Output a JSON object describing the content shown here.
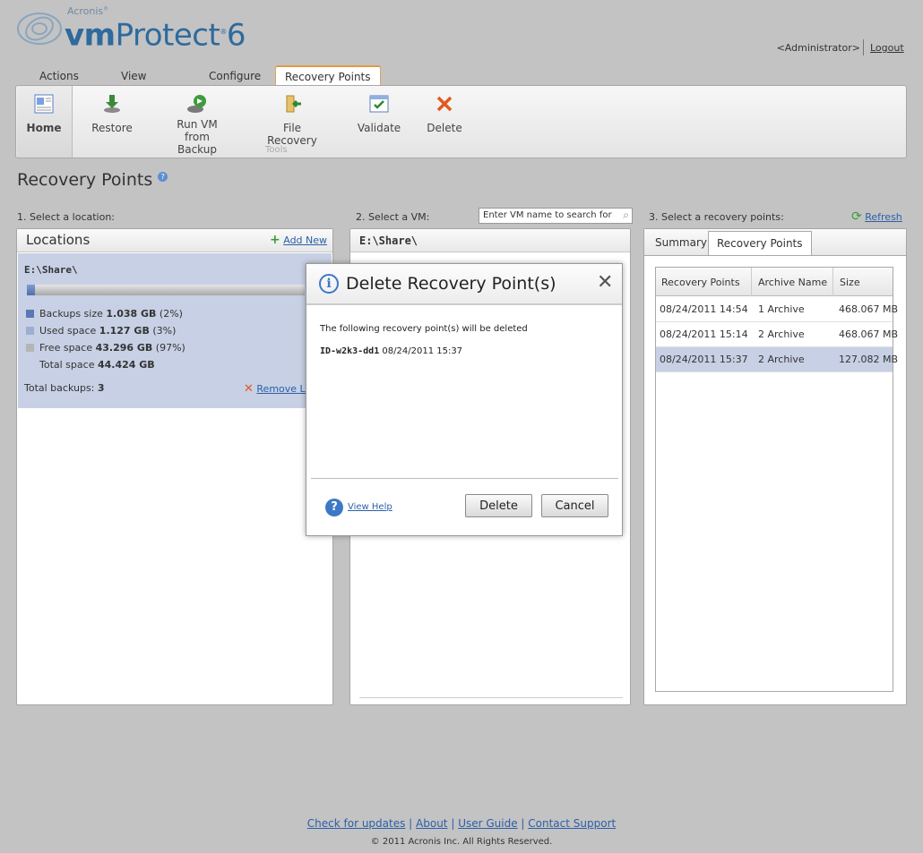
{
  "header": {
    "brand_small": "Acronis",
    "brand_strong": "vm",
    "brand_rest": "Protect",
    "brand_version": "6",
    "user": "<Administrator>",
    "logout": "Logout"
  },
  "tabs": [
    {
      "label": "Actions"
    },
    {
      "label": "View"
    },
    {
      "label": "Configure"
    },
    {
      "label": "Recovery Points",
      "active": true
    }
  ],
  "ribbon": {
    "home": "Home",
    "restore": "Restore",
    "run_vm_1": "Run VM",
    "run_vm_2": "from Backup",
    "file_recovery": "File Recovery",
    "validate": "Validate",
    "delete": "Delete",
    "tools": "Tools"
  },
  "page": {
    "title": "Recovery Points"
  },
  "locations": {
    "step": "1. Select a location:",
    "title": "Locations",
    "add_new": "Add New",
    "selected_path": "E:\\Share\\",
    "usage_fraction": 0.03,
    "backups_label": "Backups size ",
    "backups_value": "1.038 GB",
    "backups_pct": " (2%)",
    "used_label": "Used space ",
    "used_value": "1.127 GB",
    "used_pct": " (3%)",
    "free_label": "Free space ",
    "free_value": "43.296 GB",
    "free_pct": " (97%)",
    "total_label": "Total space ",
    "total_value": "44.424 GB",
    "total_backups_label": "Total backups: ",
    "total_backups_value": "3",
    "remove": "Remove Lo"
  },
  "vms": {
    "step": "2. Select a VM:",
    "search_placeholder": "Enter VM name to search for",
    "path": "E:\\Share\\"
  },
  "recovery": {
    "step": "3. Select a recovery points:",
    "refresh": "Refresh",
    "tab_summary": "Summary",
    "tab_points": "Recovery Points",
    "columns": [
      "Recovery Points",
      "Archive Name",
      "Size"
    ],
    "rows": [
      {
        "date": "08/24/2011 14:54",
        "archive": "1 Archive",
        "size": "468.067 MB"
      },
      {
        "date": "08/24/2011 15:14",
        "archive": "2 Archive",
        "size": "468.067 MB"
      },
      {
        "date": "08/24/2011 15:37",
        "archive": "2 Archive",
        "size": "127.082 MB",
        "selected": true
      }
    ]
  },
  "dialog": {
    "title": "Delete Recovery Point(s)",
    "message": "The following recovery point(s) will be deleted",
    "item_id": "ID-w2k3-dd1",
    "item_date": " 08/24/2011 15:37",
    "help": "View Help",
    "delete": "Delete",
    "cancel": "Cancel"
  },
  "footer": {
    "links": [
      "Check for updates",
      "About",
      "User Guide",
      "Contact Support"
    ],
    "copyright": "© 2011 Acronis Inc. All Rights Reserved."
  },
  "colors": {
    "accent_orange": "#e49a47",
    "brand_blue": "#2e6a9d",
    "selection": "#c7d0e4",
    "backups_legend": "#5a78b4",
    "used_legend": "#9eaed0",
    "free_legend": "#b5b5b5"
  }
}
